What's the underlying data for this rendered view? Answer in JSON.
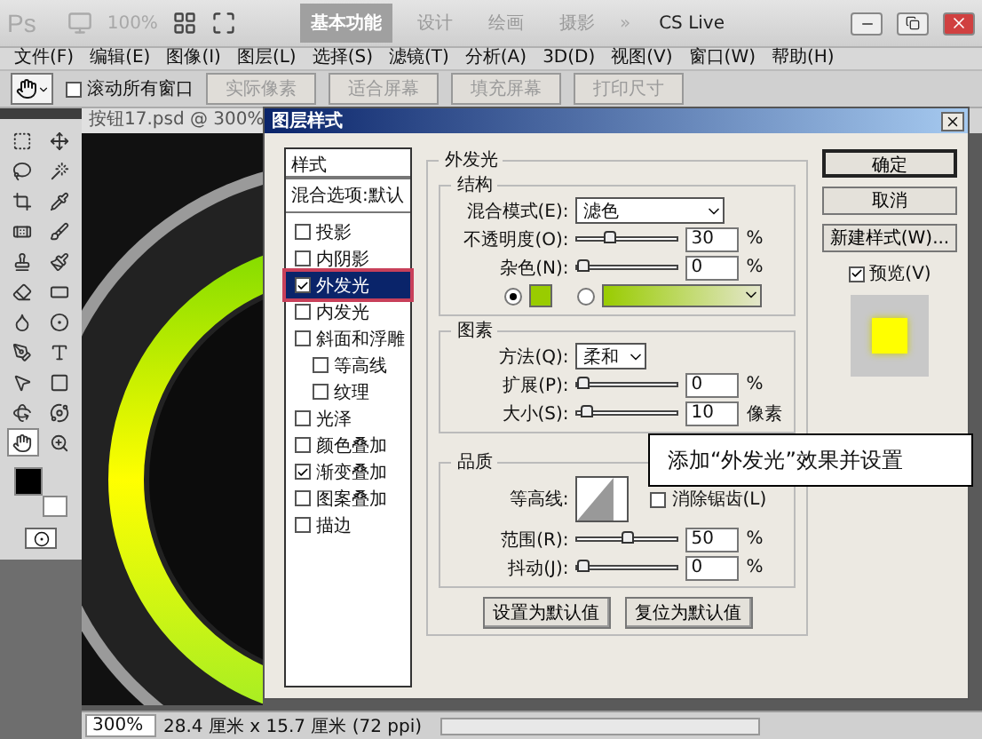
{
  "app_bar": {
    "logo": "Ps",
    "zoom": "100%",
    "workspaces": [
      {
        "label": "基本功能",
        "selected": true
      },
      {
        "label": "设计",
        "selected": false
      },
      {
        "label": "绘画",
        "selected": false
      },
      {
        "label": "摄影",
        "selected": false
      }
    ],
    "more": "»",
    "cs_live": "CS Live"
  },
  "menu": [
    "文件(F)",
    "编辑(E)",
    "图像(I)",
    "图层(L)",
    "选择(S)",
    "滤镜(T)",
    "分析(A)",
    "3D(D)",
    "视图(V)",
    "窗口(W)",
    "帮助(H)"
  ],
  "options_bar": {
    "scroll_all": {
      "label": "滚动所有窗口",
      "checked": false
    },
    "buttons": [
      {
        "label": "实际像素",
        "disabled": true
      },
      {
        "label": "适合屏幕",
        "disabled": true
      },
      {
        "label": "填充屏幕",
        "disabled": true
      },
      {
        "label": "打印尺寸",
        "disabled": true
      }
    ]
  },
  "tools": [
    {
      "kind": "marquee",
      "selected": false
    },
    {
      "kind": "move",
      "selected": false
    },
    {
      "kind": "lasso",
      "selected": false
    },
    {
      "kind": "wand",
      "selected": false
    },
    {
      "kind": "crop",
      "selected": false
    },
    {
      "kind": "eyedropper",
      "selected": false
    },
    {
      "kind": "heal",
      "selected": false
    },
    {
      "kind": "brush",
      "selected": false
    },
    {
      "kind": "stamp",
      "selected": false
    },
    {
      "kind": "history",
      "selected": false
    },
    {
      "kind": "eraser",
      "selected": false
    },
    {
      "kind": "gradient",
      "selected": false
    },
    {
      "kind": "blur",
      "selected": false
    },
    {
      "kind": "dodge",
      "selected": false
    },
    {
      "kind": "pen",
      "selected": false
    },
    {
      "kind": "type",
      "selected": false
    },
    {
      "kind": "path",
      "selected": false
    },
    {
      "kind": "shape",
      "selected": false
    },
    {
      "kind": "rotate",
      "selected": false
    },
    {
      "kind": "orbit",
      "selected": false
    },
    {
      "kind": "hand",
      "selected": true
    },
    {
      "kind": "zoom",
      "selected": false
    }
  ],
  "document": {
    "tab": "按钮17.psd @ 300%",
    "zoom": "300%",
    "info": "28.4 厘米 x 15.7 厘米 (72 ppi)"
  },
  "dialog": {
    "title": "图层样式",
    "styles_header": "样式",
    "blending": "混合选项:默认",
    "styles": [
      {
        "label": "投影",
        "checked": false,
        "selected": false
      },
      {
        "label": "内阴影",
        "checked": false,
        "selected": false
      },
      {
        "label": "外发光",
        "checked": true,
        "selected": true
      },
      {
        "label": "内发光",
        "checked": false,
        "selected": false
      },
      {
        "label": "斜面和浮雕",
        "checked": false,
        "selected": false,
        "children": [
          {
            "label": "等高线",
            "checked": false,
            "selected": false
          },
          {
            "label": "纹理",
            "checked": false,
            "selected": false
          }
        ]
      },
      {
        "label": "光泽",
        "checked": false,
        "selected": false
      },
      {
        "label": "颜色叠加",
        "checked": false,
        "selected": false
      },
      {
        "label": "渐变叠加",
        "checked": true,
        "selected": false
      },
      {
        "label": "图案叠加",
        "checked": false,
        "selected": false
      },
      {
        "label": "描边",
        "checked": false,
        "selected": false
      }
    ],
    "panel": {
      "title": "外发光",
      "structure": {
        "title": "结构",
        "blend_mode": {
          "label": "混合模式(E):",
          "value": "滤色"
        },
        "opacity": {
          "label": "不透明度(O):",
          "level": 0.3,
          "value": "30",
          "unit": "%"
        },
        "noise": {
          "label": "杂色(N):",
          "level": 0,
          "value": "0",
          "unit": "%"
        },
        "fill": [
          {
            "kind": "color",
            "selected": true
          },
          {
            "kind": "gradient",
            "selected": false
          }
        ]
      },
      "elements": {
        "title": "图素",
        "technique": {
          "label": "方法(Q):",
          "value": "柔和"
        },
        "spread": {
          "label": "扩展(P):",
          "level": 0,
          "value": "0",
          "unit": "%"
        },
        "size": {
          "label": "大小(S):",
          "level": 0.04,
          "value": "10",
          "unit": "像素"
        }
      },
      "quality": {
        "title": "品质",
        "contour_label": "等高线:",
        "anti_alias": {
          "label": "消除锯齿(L)",
          "checked": false
        },
        "range": {
          "label": "范围(R):",
          "level": 0.5,
          "value": "50",
          "unit": "%"
        },
        "jitter": {
          "label": "抖动(J):",
          "level": 0,
          "value": "0",
          "unit": "%"
        }
      },
      "buttons": [
        "设置为默认值",
        "复位为默认值"
      ]
    },
    "actions": [
      "确定",
      "取消",
      "新建样式(W)..."
    ],
    "preview": {
      "label": "预览(V)",
      "checked": true
    }
  },
  "callout": "添加“外发光”效果并设置"
}
